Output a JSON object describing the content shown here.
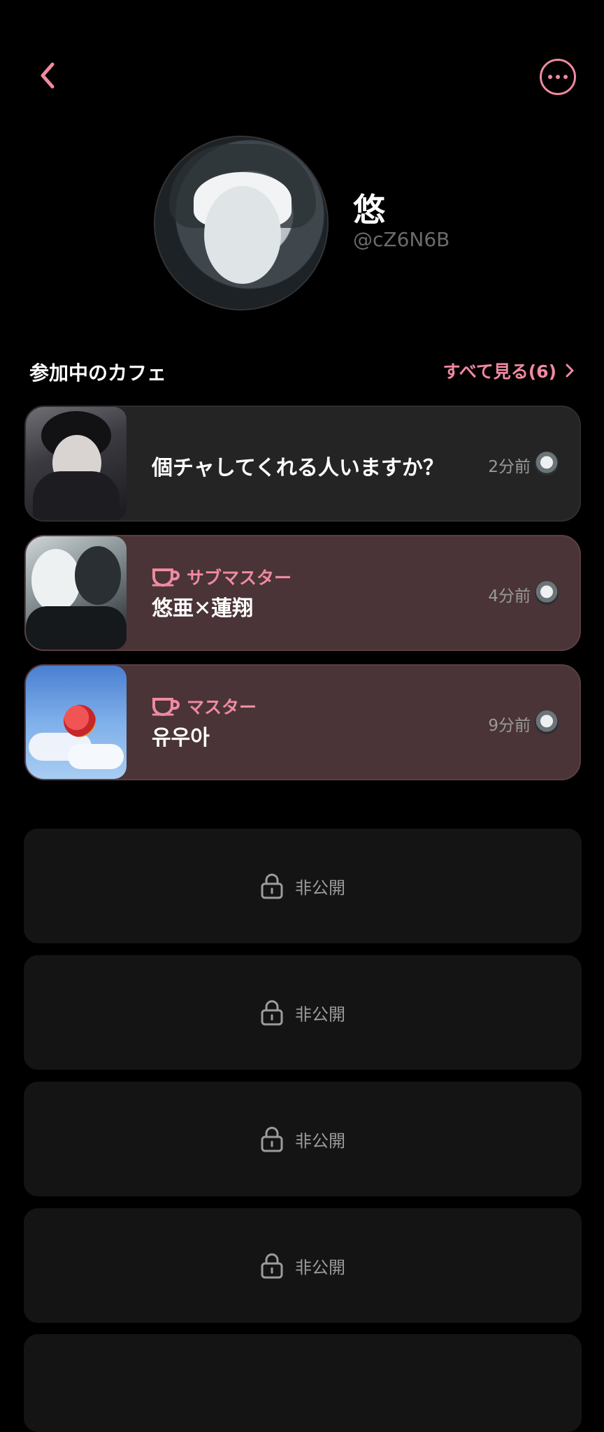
{
  "header": {
    "back_icon": "chevron-left-icon",
    "more_icon": "more-horizontal-icon",
    "accent_color": "#ef8aa0"
  },
  "profile": {
    "name": "悠",
    "handle": "@cZ6N6B"
  },
  "cafes_section": {
    "title": "参加中のカフェ",
    "see_all_label": "すべて見る(6)"
  },
  "cafes": [
    {
      "name": "個チャしてくれる人いますか？",
      "role": "",
      "time": "2分前"
    },
    {
      "name": "悠亜✕蓮翔",
      "role": "サブマスター",
      "time": "4分前"
    },
    {
      "name": "유우아",
      "role": "マスター",
      "time": "9分前"
    }
  ],
  "private_items": [
    {
      "label": "非公開"
    },
    {
      "label": "非公開"
    },
    {
      "label": "非公開"
    },
    {
      "label": "非公開"
    }
  ]
}
